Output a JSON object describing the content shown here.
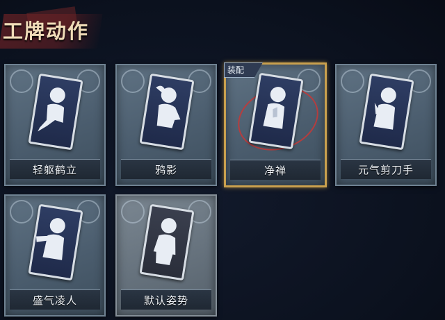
{
  "header": {
    "title": "工牌动作"
  },
  "cards": [
    {
      "label": "轻躯鹤立",
      "equipped": false
    },
    {
      "label": "鸦影",
      "equipped": false
    },
    {
      "label": "净禅",
      "equipped": true,
      "tag": "装配"
    },
    {
      "label": "元气剪刀手",
      "equipped": false
    },
    {
      "label": "盛气凌人",
      "equipped": false
    },
    {
      "label": "默认姿势",
      "equipped": false
    }
  ],
  "colors": {
    "equipped_border": "#c9a04e",
    "title_text": "#f0dcb8",
    "ring": "#c03a3a"
  }
}
